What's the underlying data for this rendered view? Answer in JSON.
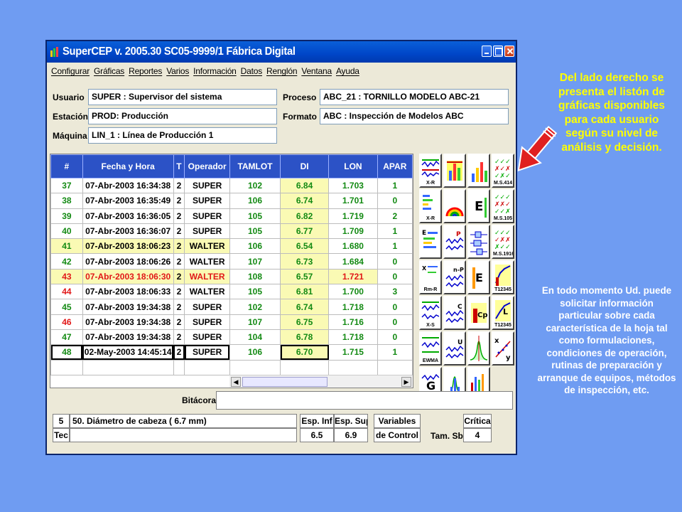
{
  "window": {
    "title": "SuperCEP v. 2005.30  SC05-9999/1  Fábrica Digital",
    "menu": [
      "Configurar",
      "Gráficas",
      "Reportes",
      "Varios",
      "Información",
      "Datos",
      "Renglón",
      "Ventana",
      "Ayuda"
    ]
  },
  "header": {
    "usuario_label": "Usuario",
    "usuario_value": "SUPER   : Supervisor del sistema",
    "estacion_label": "Estación",
    "estacion_value": "PROD: Producción",
    "maquina_label": "Máquina",
    "maquina_value": "LIN_1   : Línea de Producción 1",
    "proceso_label": "Proceso",
    "proceso_value": "ABC_21       : TORNILLO MODELO ABC-21",
    "formato_label": "Formato",
    "formato_value": "ABC    : Inspección de Modelos ABC"
  },
  "table": {
    "columns": [
      "#",
      "Fecha y Hora",
      "T",
      "Operador",
      "TAMLOT",
      "DI",
      "LON",
      "APAR"
    ],
    "rows": [
      {
        "num": "37",
        "fecha": "07-Abr-2003  16:34:38",
        "t": "2",
        "op": "SUPER",
        "tamlot": "102",
        "di": "6.84",
        "lon": "1.703",
        "apar": "1"
      },
      {
        "num": "38",
        "fecha": "07-Abr-2003  16:35:49",
        "t": "2",
        "op": "SUPER",
        "tamlot": "106",
        "di": "6.74",
        "lon": "1.701",
        "apar": "0"
      },
      {
        "num": "39",
        "fecha": "07-Abr-2003  16:36:05",
        "t": "2",
        "op": "SUPER",
        "tamlot": "105",
        "di": "6.82",
        "lon": "1.719",
        "apar": "2"
      },
      {
        "num": "40",
        "fecha": "07-Abr-2003  16:36:07",
        "t": "2",
        "op": "SUPER",
        "tamlot": "105",
        "di": "6.77",
        "lon": "1.709",
        "apar": "1"
      },
      {
        "num": "41",
        "fecha": "07-Abr-2003  18:06:23",
        "t": "2",
        "op": "WALTER",
        "tamlot": "106",
        "di": "6.54",
        "lon": "1.680",
        "apar": "1"
      },
      {
        "num": "42",
        "fecha": "07-Abr-2003  18:06:26",
        "t": "2",
        "op": "WALTER",
        "tamlot": "107",
        "di": "6.73",
        "lon": "1.684",
        "apar": "0"
      },
      {
        "num": "43",
        "fecha": "07-Abr-2003  18:06:30",
        "t": "2",
        "op": "WALTER",
        "tamlot": "108",
        "di": "6.57",
        "lon": "1.721",
        "apar": "0"
      },
      {
        "num": "44",
        "fecha": "07-Abr-2003  18:06:33",
        "t": "2",
        "op": "WALTER",
        "tamlot": "105",
        "di": "6.81",
        "lon": "1.700",
        "apar": "3"
      },
      {
        "num": "45",
        "fecha": "07-Abr-2003  19:34:38",
        "t": "2",
        "op": "SUPER",
        "tamlot": "102",
        "di": "6.74",
        "lon": "1.718",
        "apar": "0"
      },
      {
        "num": "46",
        "fecha": "07-Abr-2003  19:34:38",
        "t": "2",
        "op": "SUPER",
        "tamlot": "107",
        "di": "6.75",
        "lon": "1.716",
        "apar": "0"
      },
      {
        "num": "47",
        "fecha": "07-Abr-2003  19:34:38",
        "t": "2",
        "op": "SUPER",
        "tamlot": "104",
        "di": "6.78",
        "lon": "1.718",
        "apar": "0"
      },
      {
        "num": "48",
        "fecha": "02-May-2003  14:45:14",
        "t": "2",
        "op": "SUPER",
        "tamlot": "106",
        "di": "6.70",
        "lon": "1.715",
        "apar": "1"
      }
    ]
  },
  "palette": {
    "labels": [
      "X-R",
      "M.S.414",
      "X-R",
      "M.S.105",
      "M.S.1916",
      "Rm-R",
      "T12345",
      "X-S",
      "T12345",
      "EWMA"
    ]
  },
  "bottom": {
    "bitacora_label": "Bitácora",
    "var_num": "5",
    "var_name": "50. Diámetro de cabeza ( 6.7 mm)",
    "tec_label": "Tec",
    "esp_inf_label": "Esp. Inf",
    "esp_sup_label": "Esp. Sup",
    "esp_inf_value": "6.5",
    "esp_sup_value": "6.9",
    "variables_label": "Variables",
    "control_label": "de Control",
    "tam_label": "Tam. Sbg.",
    "critica_label": "Crítica",
    "critica_value": "4"
  },
  "annotation": {
    "side_top": "Del lado derecho se presenta el listón de gráficas disponibles para cada usuario según su nivel de análisis y decisión.",
    "side_bottom": "En todo momento Ud. puede solicitar información particular sobre cada característica de la hoja tal como formulaciones, condiciones de operación, rutinas de preparación y arranque de equipos, métodos de inspección, etc."
  },
  "colors": {
    "background": "#6f9cf2",
    "header": "#2c52c6",
    "accent_text": "#ffff00",
    "arrow": "#e02020"
  }
}
